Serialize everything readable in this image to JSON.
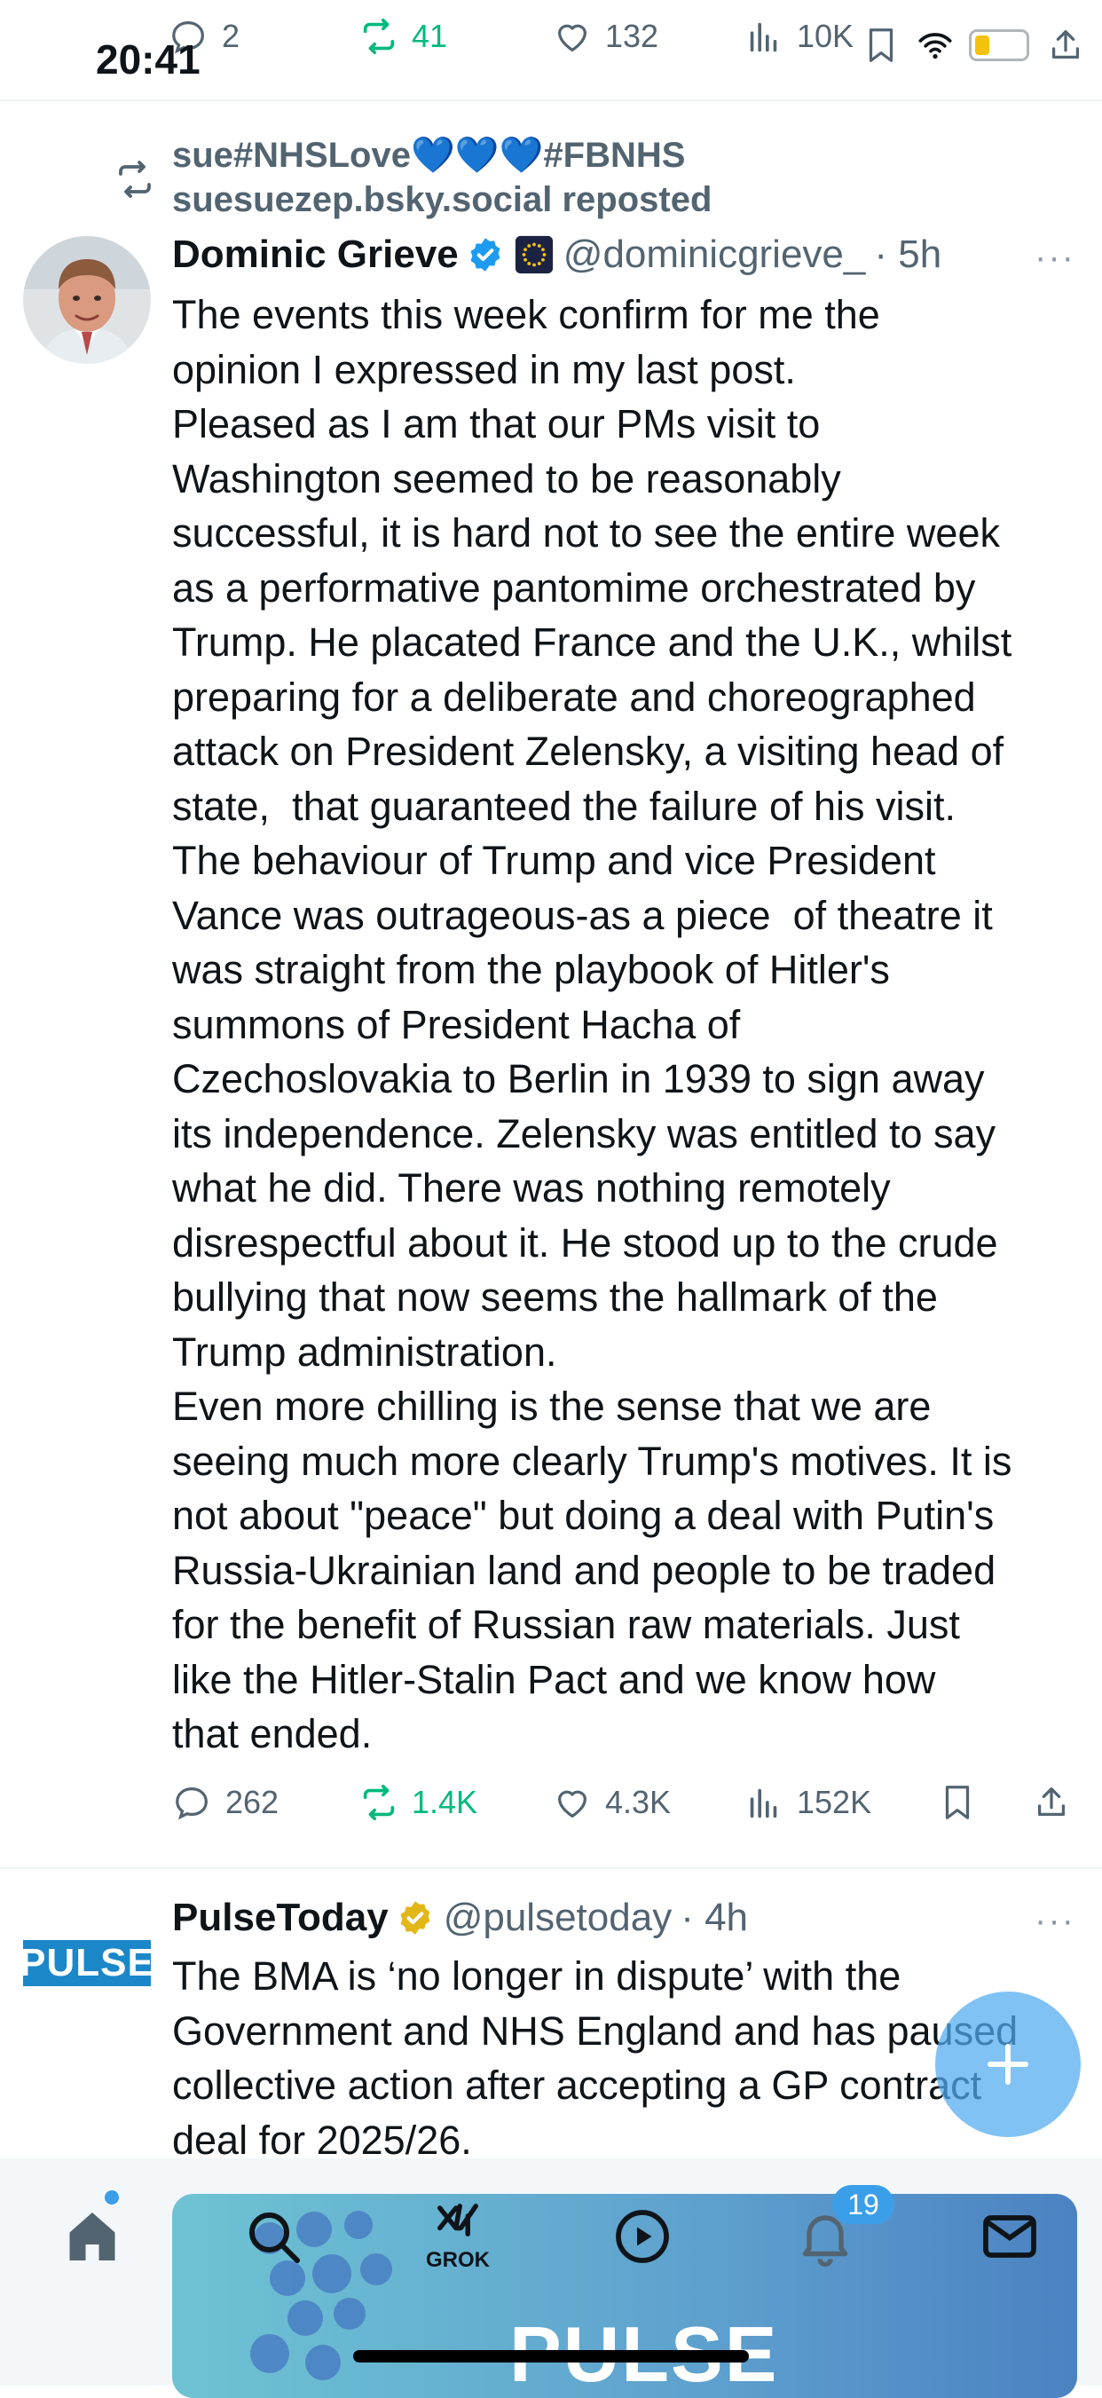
{
  "status_bar": {
    "time": "20:41"
  },
  "top_post_actions": {
    "replies": "2",
    "reposts": "41",
    "likes": "132",
    "views": "10K"
  },
  "post1": {
    "repost_banner_line1": "sue#NHSLove💙💙💙#FBNHS",
    "repost_banner_line2": "suesuezep.bsky.social reposted",
    "author_name": "Dominic Grieve",
    "handle": "@dominicgrieve_",
    "time": "· 5h",
    "more": "···",
    "text": "The events this week confirm for me the\nopinion I expressed in my last post.\nPleased as I am that our PMs visit to\nWashington seemed to be reasonably\nsuccessful, it is hard not to see the entire week\nas a performative pantomime orchestrated by\nTrump. He placated France and the U.K., whilst\npreparing for a deliberate and choreographed\nattack on President Zelensky, a visiting head of\nstate,  that guaranteed the failure of his visit.\nThe behaviour of Trump and vice President\nVance was outrageous-as a piece  of theatre it\nwas straight from the playbook of Hitler's\nsummons of President Hacha of\nCzechoslovakia to Berlin in 1939 to sign away\nits independence. Zelensky was entitled to say\nwhat he did. There was nothing remotely\ndisrespectful about it. He stood up to the crude\nbullying that now seems the hallmark of the\nTrump administration.\nEven more chilling is the sense that we are\nseeing much more clearly Trump's motives. It is\nnot about \"peace\" but doing a deal with Putin's\nRussia-Ukrainian land and people to be traded\nfor the benefit of Russian raw materials. Just\nlike the Hitler-Stalin Pact and we know how\nthat ended.",
    "actions": {
      "replies": "262",
      "reposts": "1.4K",
      "likes": "4.3K",
      "views": "152K"
    }
  },
  "post2": {
    "avatar_text": "PULSE",
    "author_name": "PulseToday",
    "handle": "@pulsetoday",
    "time": "· 4h",
    "more": "···",
    "text": "The BMA is ‘no longer in dispute’ with the\nGovernment and NHS England and has paused\ncollective action after accepting a GP contract\ndeal for 2025/26."
  },
  "bottom_nav": {
    "grok_label": "GROK",
    "notifications_badge": "19",
    "ad_text": "PULSE"
  },
  "colors": {
    "accent_blue": "#1d9bf0",
    "repost_green": "#00ba7c",
    "muted_text": "#536471",
    "gold_verified": "#e2b719"
  }
}
